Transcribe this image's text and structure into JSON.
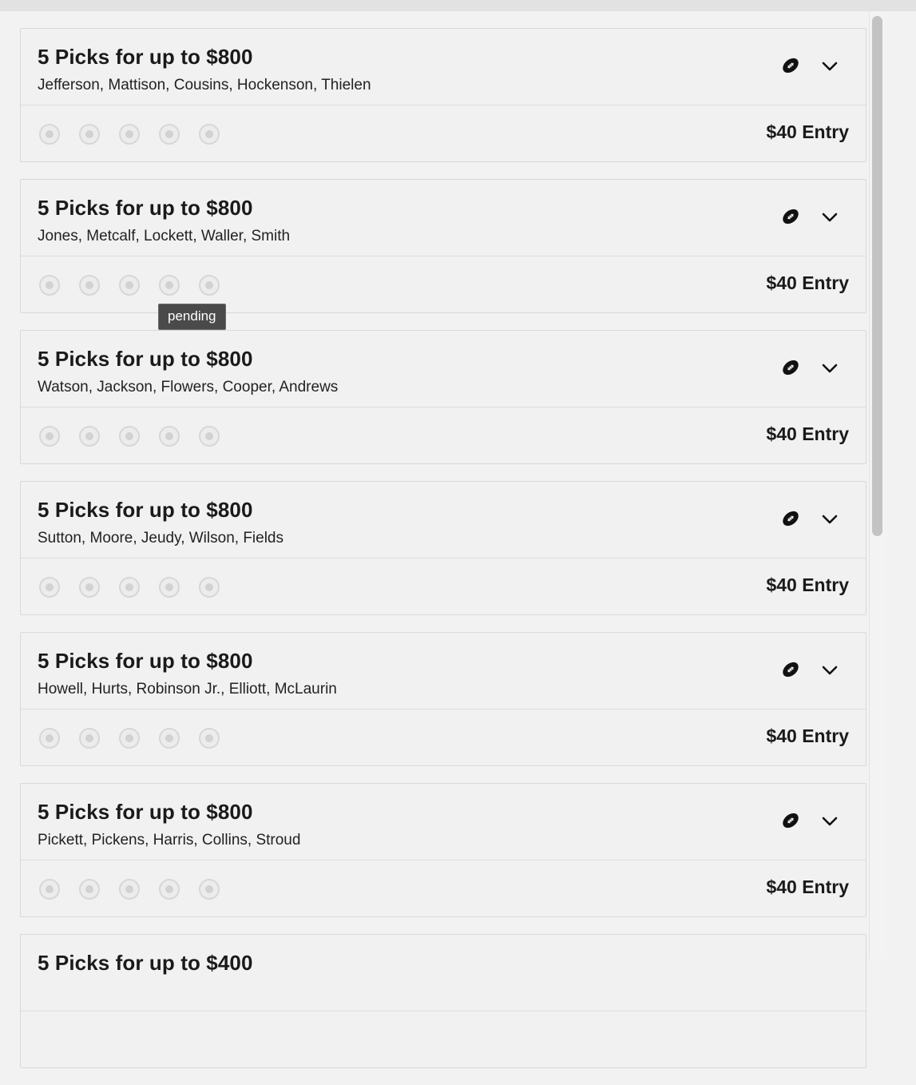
{
  "cards": [
    {
      "title": "5 Picks for up to $800",
      "players": "Jefferson, Mattison, Cousins, Hockenson, Thielen",
      "entry": "$40 Entry"
    },
    {
      "title": "5 Picks for up to $800",
      "players": "Jones, Metcalf, Lockett, Waller, Smith",
      "entry": "$40 Entry"
    },
    {
      "title": "5 Picks for up to $800",
      "players": "Watson, Jackson, Flowers, Cooper, Andrews",
      "entry": "$40 Entry"
    },
    {
      "title": "5 Picks for up to $800",
      "players": "Sutton, Moore, Jeudy, Wilson, Fields",
      "entry": "$40 Entry"
    },
    {
      "title": "5 Picks for up to $800",
      "players": "Howell, Hurts, Robinson Jr., Elliott, McLaurin",
      "entry": "$40 Entry"
    },
    {
      "title": "5 Picks for up to $800",
      "players": "Pickett, Pickens, Harris, Collins, Stroud",
      "entry": "$40 Entry"
    },
    {
      "title": "5 Picks for up to $400",
      "players": "",
      "entry": ""
    }
  ],
  "pick_status": "pending",
  "icons": {
    "sport": "football-icon",
    "expand": "chevron-down-icon",
    "pick": "radio-pending-icon"
  },
  "colors": {
    "background": "#f2f2f2",
    "card_border": "#d9d9d9",
    "tooltip_bg": "#4a4a4a",
    "pick_dot": "#d2d2d2"
  }
}
